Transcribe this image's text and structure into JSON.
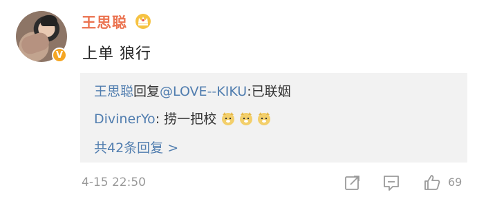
{
  "post": {
    "username": "王思聪",
    "text": "上单 狼行",
    "time": "4-15 22:50",
    "like_count": "69"
  },
  "replies": [
    {
      "author": "王思聪",
      "verb": "回复",
      "mention": "@LOVE--KIKU",
      "text": ":已联姻"
    },
    {
      "author": "DivinerYo",
      "text": ": 捞一把校"
    }
  ],
  "more_replies_label": "共42条回复 >",
  "icons": {
    "vip": "crown-icon",
    "verified": "verified-v-icon",
    "emoji": "doge-emoji-icon",
    "share": "share-icon",
    "comment": "comment-icon",
    "like": "like-icon"
  },
  "colors": {
    "username": "#eb7350",
    "link": "#507daf",
    "muted": "#999999",
    "reply_bg": "#f2f2f2",
    "badge": "#f5a623"
  }
}
